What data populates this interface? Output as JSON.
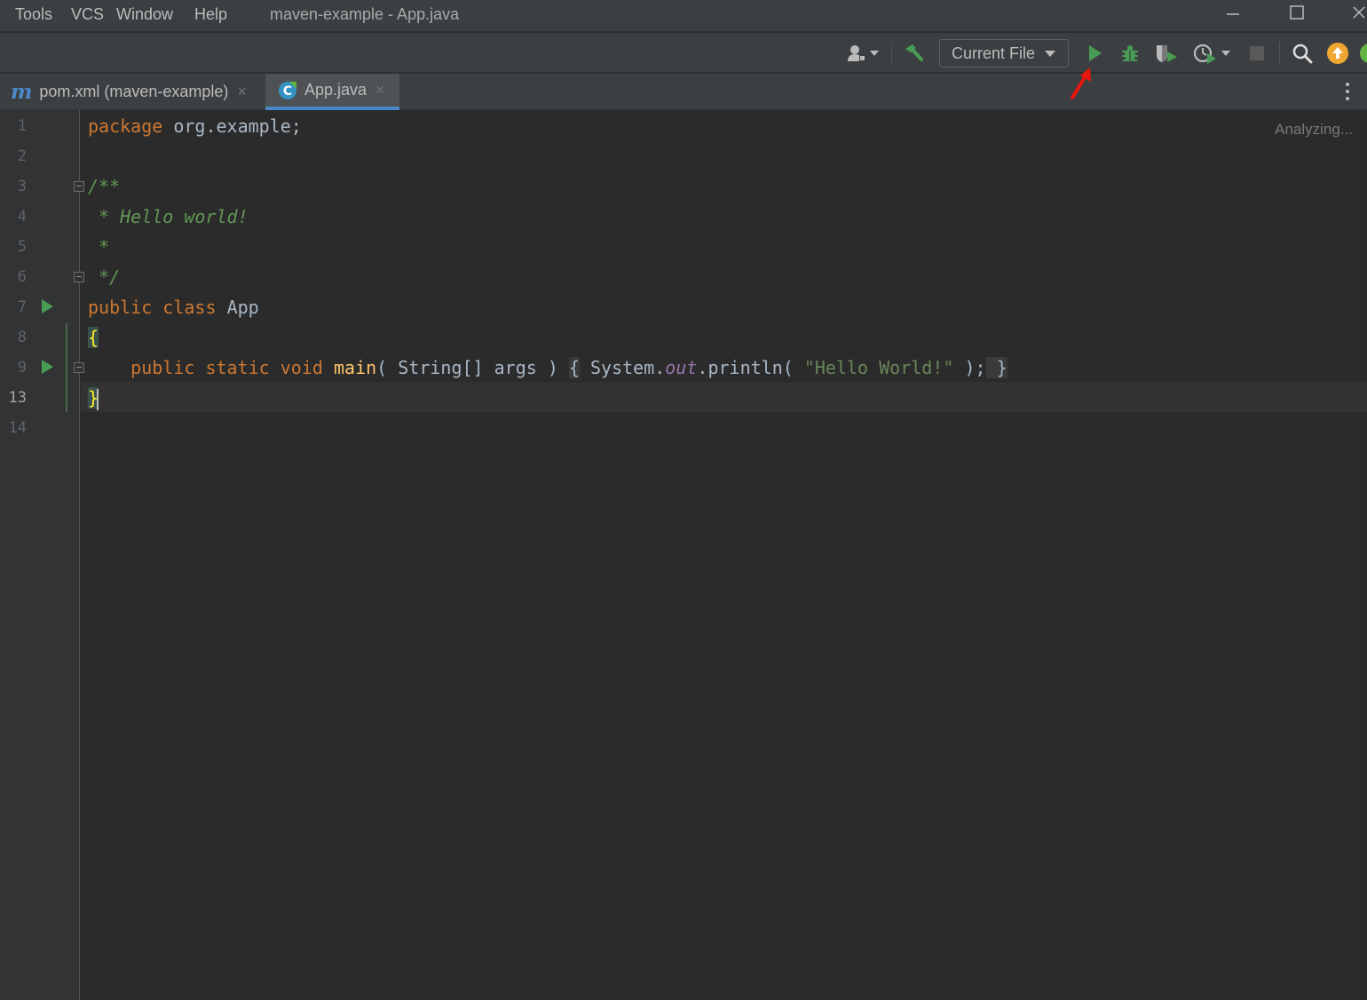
{
  "menu": {
    "tools": "Tools",
    "vcs": "VCS",
    "window": "Window",
    "help": "Help"
  },
  "window_title": "maven-example - App.java",
  "toolbar": {
    "run_config": "Current File"
  },
  "tabs": [
    {
      "label": "pom.xml (maven-example)",
      "close": "×"
    },
    {
      "label": "App.java",
      "close": "×"
    }
  ],
  "editor": {
    "status": "Analyzing...",
    "line_numbers": [
      "1",
      "2",
      "3",
      "4",
      "5",
      "6",
      "7",
      "8",
      "9",
      "13",
      "14"
    ],
    "current_line": "13",
    "lines": {
      "l1": {
        "kw": "package",
        "rest": " org.example;"
      },
      "l3": "/**",
      "l4": " * Hello world!",
      "l5": " *",
      "l6": " */",
      "l7": {
        "kw1": "public",
        "kw2": "class",
        "name": "App"
      },
      "l8": "{",
      "l9": {
        "kw1": "public",
        "kw2": "static",
        "kw3": "void",
        "fn": "main",
        "params": "( String[] args ) ",
        "open": "{",
        "sys": " System.",
        "out": "out",
        "call": ".println( ",
        "str": "\"Hello World!\"",
        "tail": " );",
        "close": " }"
      },
      "l13": "}"
    }
  },
  "colors": {
    "keyword": "#cc7832",
    "comment": "#629755",
    "string": "#6a8759",
    "function": "#ffc66d",
    "run_green": "#499c54",
    "accent_blue": "#4a88c7",
    "annotation_red": "#e8160c"
  }
}
